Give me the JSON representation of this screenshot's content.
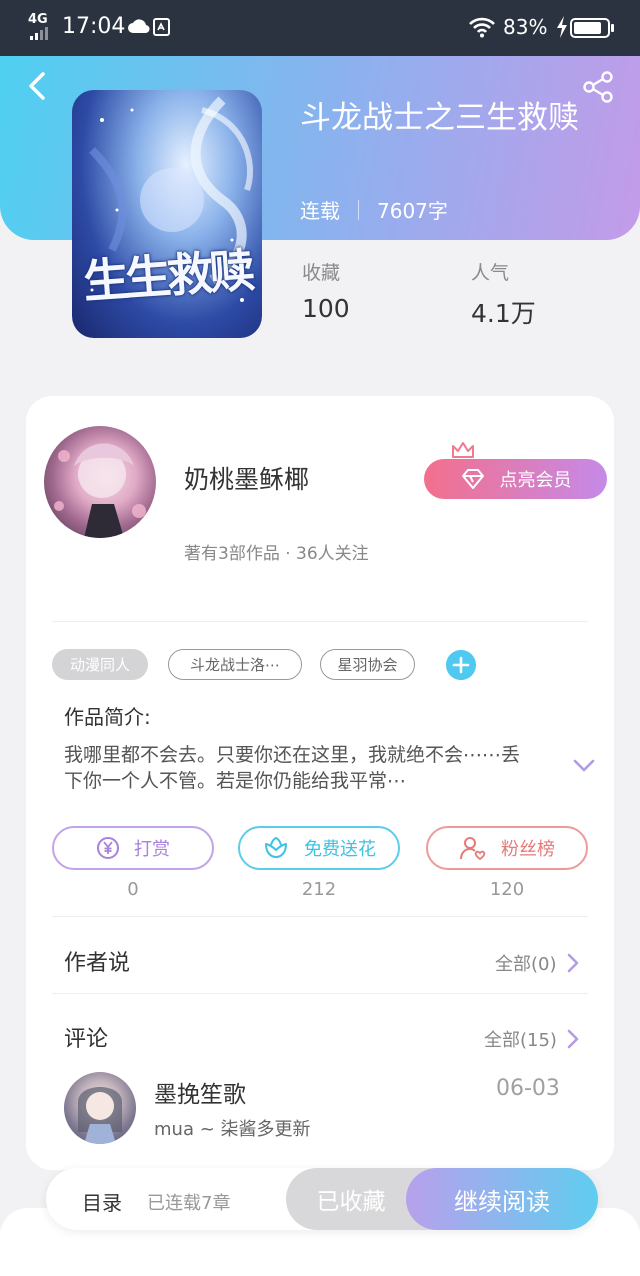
{
  "status_bar": {
    "network": "4G",
    "time": "17:04",
    "battery": "83%",
    "battery_level": 0.83
  },
  "book": {
    "title": "斗龙战士之三生救赎",
    "status": "连载",
    "word_count": "7607字",
    "favorites_label": "收藏",
    "favorites_value": "100",
    "popularity_label": "人气",
    "popularity_value": "4.1万"
  },
  "author": {
    "name": "奶桃墨稣椰",
    "subtitle": "著有3部作品 · 36人关注",
    "vip_button": "点亮会员"
  },
  "tags": [
    "动漫同人",
    "斗龙战士洛⋯",
    "星羽协会"
  ],
  "intro": {
    "label": "作品简介:",
    "text": "我哪里都不会去。只要你还在这里，我就绝不会⋯⋯丢下你一个人不管。若是你仍能给我平常⋯"
  },
  "actions": [
    {
      "label": "打赏",
      "count": "0"
    },
    {
      "label": "免费送花",
      "count": "212"
    },
    {
      "label": "粉丝榜",
      "count": "120"
    }
  ],
  "author_says": {
    "title": "作者说",
    "link": "全部(0)"
  },
  "comments": {
    "title": "评论",
    "link": "全部(15)",
    "items": [
      {
        "user": "墨挽笙歌",
        "date": "06-03",
        "text": "mua ~ 柒酱多更新"
      }
    ]
  },
  "bottom_bar": {
    "toc_label": "目录",
    "toc_sub": "已连载7章",
    "favorite_button": "已收藏",
    "read_button": "继续阅读"
  },
  "colors": {
    "header_gradient_start": "#4fd0f0",
    "header_gradient_end": "#c39be9",
    "vip_gradient_start": "#f36f8c",
    "vip_gradient_end": "#c58ae8",
    "accent_cyan": "#4fc9f0",
    "tip_purple": "#a781dc",
    "fans_red": "#e57a7a"
  },
  "icons": [
    "back-arrow-icon",
    "share-icon",
    "crown-icon",
    "diamond-icon",
    "plus-icon",
    "chevron-down-icon",
    "yen-icon",
    "flower-icon",
    "user-heart-icon",
    "chevron-right-icon",
    "wifi-icon",
    "cloud-icon",
    "sim-icon",
    "bolt-icon"
  ]
}
